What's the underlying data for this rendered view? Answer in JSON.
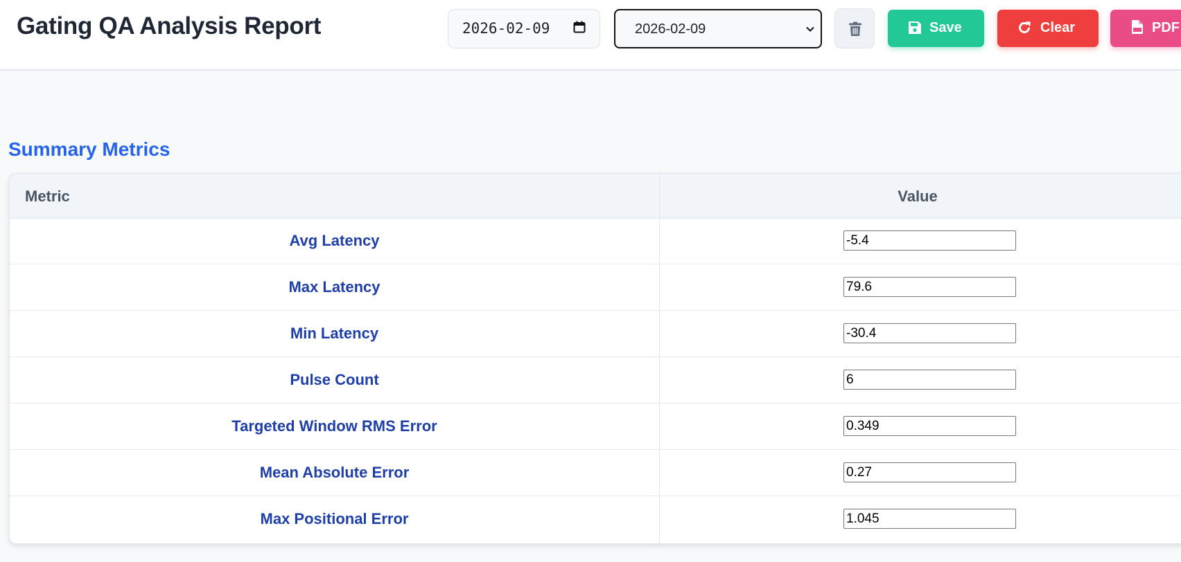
{
  "header": {
    "title": "Gating QA Analysis Report",
    "date_input_value": "2026-02-09",
    "date_select_value": "2026-02-09",
    "buttons": {
      "save": "Save",
      "clear": "Clear",
      "pdf": "PDF"
    }
  },
  "colors": {
    "accent_blue": "#2563eb",
    "save_green": "#22c997",
    "clear_red": "#ef3e3e",
    "pdf_pink": "#ea4c86"
  },
  "summary": {
    "title": "Summary Metrics",
    "columns": [
      "Metric",
      "Value"
    ],
    "rows": [
      {
        "metric": "Avg Latency",
        "value": "-5.4"
      },
      {
        "metric": "Max Latency",
        "value": "79.6"
      },
      {
        "metric": "Min Latency",
        "value": "-30.4"
      },
      {
        "metric": "Pulse Count",
        "value": "6"
      },
      {
        "metric": "Targeted Window RMS Error",
        "value": "0.349"
      },
      {
        "metric": "Mean Absolute Error",
        "value": "0.27"
      },
      {
        "metric": "Max Positional Error",
        "value": "1.045"
      }
    ]
  }
}
